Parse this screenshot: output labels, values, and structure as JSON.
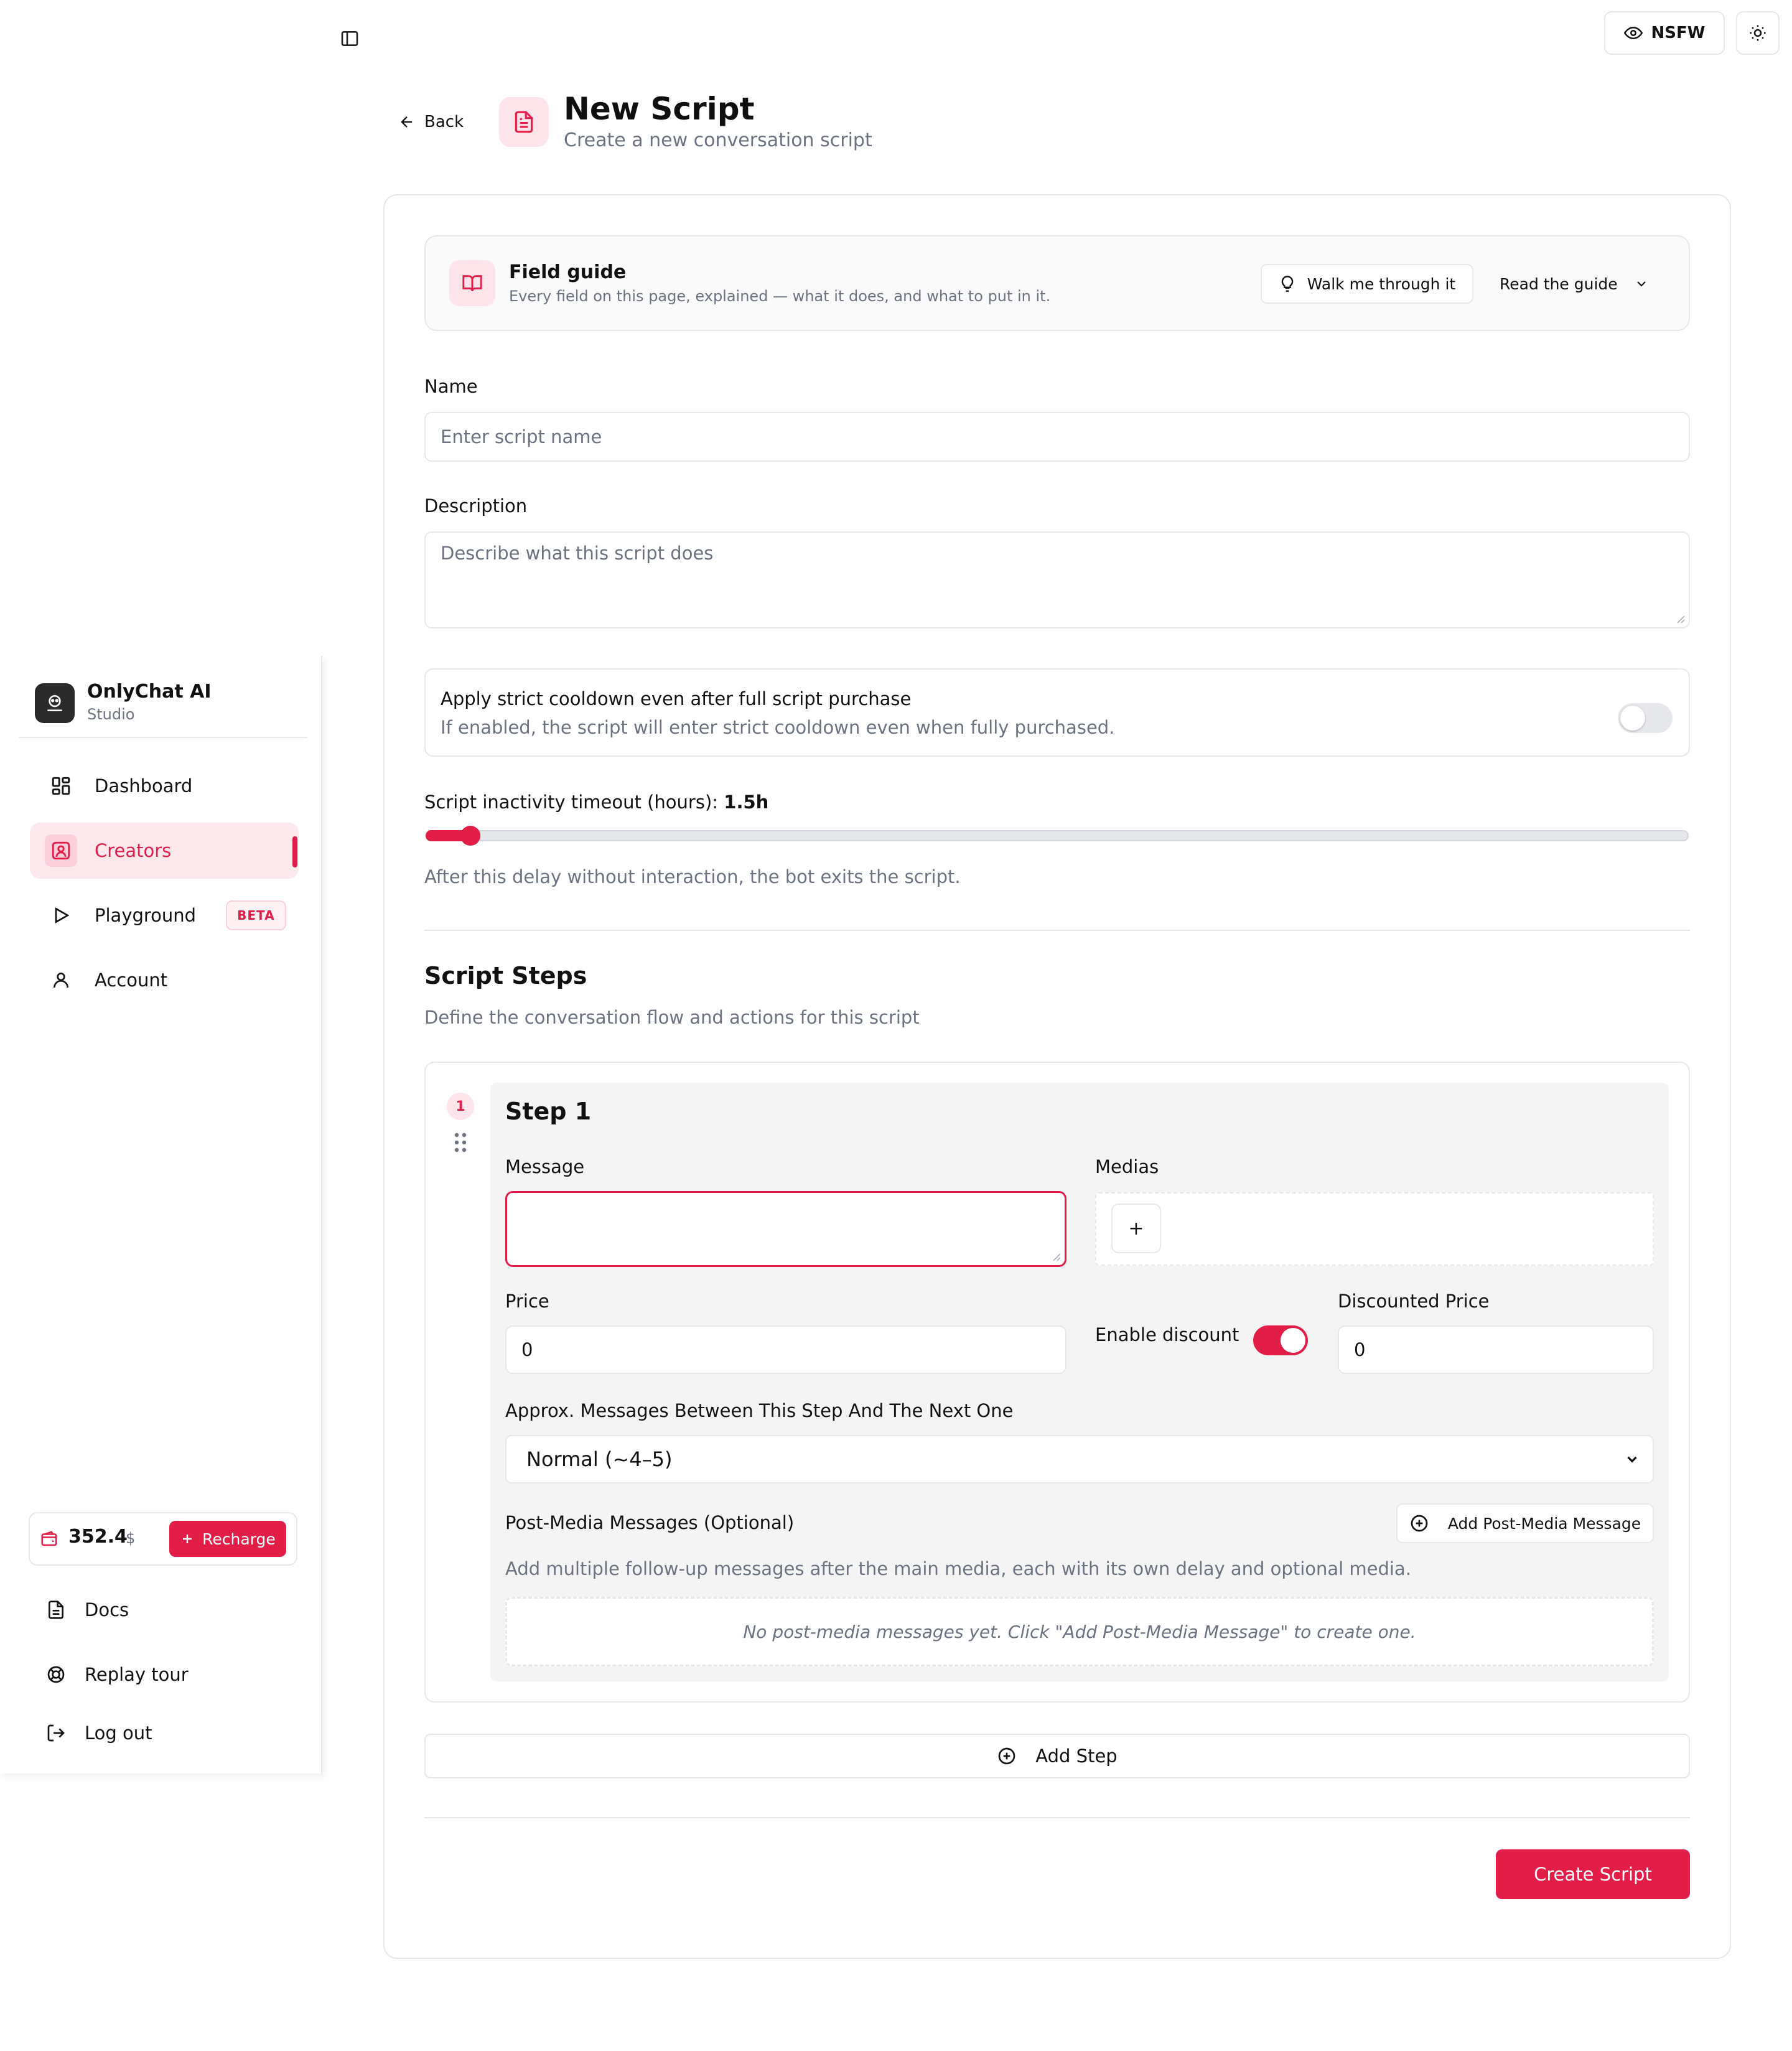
{
  "topbar": {
    "nsfw_label": "NSFW"
  },
  "header": {
    "back_label": "Back",
    "title": "New Script",
    "subtitle": "Create a new conversation script"
  },
  "field_guide": {
    "title": "Field guide",
    "description": "Every field on this page, explained — what it does, and what to put in it.",
    "walk_label": "Walk me through it",
    "read_label": "Read the guide"
  },
  "form": {
    "name_label": "Name",
    "name_placeholder": "Enter script name",
    "description_label": "Description",
    "description_placeholder": "Describe what this script does",
    "cooldown_title": "Apply strict cooldown even after full script purchase",
    "cooldown_desc": "If enabled, the script will enter strict cooldown even when fully purchased.",
    "cooldown_enabled": false,
    "timeout_label": "Script inactivity timeout (hours):",
    "timeout_value": "1.5h",
    "timeout_fraction": 0.028,
    "timeout_help": "After this delay without interaction, the bot exits the script."
  },
  "steps": {
    "title": "Script Steps",
    "description": "Define the conversation flow and actions for this script",
    "items": [
      {
        "number": "1",
        "title": "Step 1",
        "message_label": "Message",
        "message_value": "",
        "medias_label": "Medias",
        "medias_add": "+",
        "price_label": "Price",
        "price_value": "0",
        "discount_label": "Enable discount",
        "discount_enabled": true,
        "discounted_label": "Discounted Price",
        "discounted_value": "0",
        "gap_label": "Approx. Messages Between This Step And The Next One",
        "gap_value": "Normal (~4–5)",
        "postmedia_label": "Post-Media Messages (Optional)",
        "postmedia_add": "Add Post-Media Message",
        "postmedia_help": "Add multiple follow-up messages after the main media, each with its own delay and optional media.",
        "postmedia_empty": "No post-media messages yet. Click \"Add Post-Media Message\" to create one."
      }
    ],
    "add_label": "Add Step"
  },
  "actions": {
    "create_label": "Create Script"
  },
  "sidebar": {
    "brand_name": "OnlyChat AI",
    "brand_sub": "Studio",
    "items": [
      {
        "label": "Dashboard",
        "icon": "dashboard-icon"
      },
      {
        "label": "Creators",
        "icon": "creators-icon",
        "active": true
      },
      {
        "label": "Playground",
        "icon": "play-icon",
        "badge": "BETA"
      },
      {
        "label": "Account",
        "icon": "user-icon"
      }
    ],
    "wallet_amount": "352.4",
    "wallet_currency": "$",
    "recharge_label": "Recharge",
    "footer": [
      {
        "label": "Docs",
        "icon": "docs-icon"
      },
      {
        "label": "Replay tour",
        "icon": "lifebuoy-icon"
      },
      {
        "label": "Log out",
        "icon": "logout-icon"
      }
    ]
  },
  "colors": {
    "accent": "#e11d48",
    "accent_soft": "#fde4ea",
    "border": "#e5e7eb",
    "muted": "#6b7280"
  }
}
